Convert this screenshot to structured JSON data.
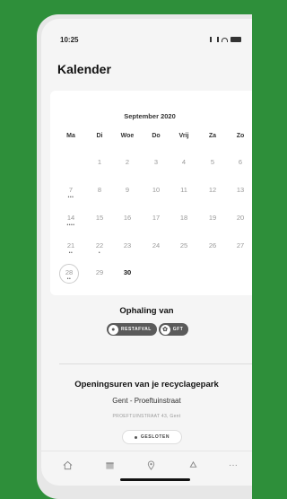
{
  "status_bar": {
    "time": "10:25"
  },
  "header": {
    "title": "Kalender"
  },
  "calendar": {
    "month": "September 2020",
    "weekdays": [
      "Ma",
      "Di",
      "Woe",
      "Do",
      "Vrij",
      "Za",
      "Zo"
    ],
    "weeks": [
      [
        "",
        "1",
        "2",
        "3",
        "4",
        "5",
        "6"
      ],
      [
        "7",
        "8",
        "9",
        "10",
        "11",
        "12",
        "13"
      ],
      [
        "14",
        "15",
        "16",
        "17",
        "18",
        "19",
        "20"
      ],
      [
        "21",
        "22",
        "23",
        "24",
        "25",
        "26",
        "27"
      ],
      [
        "28",
        "29",
        "30",
        "",
        "",
        "",
        ""
      ]
    ]
  },
  "ophaling": {
    "title": "Ophaling van",
    "items": [
      {
        "label": "RESTAFVAL",
        "icon": "trash-bag-icon"
      },
      {
        "label": "GFT",
        "icon": "leaf-icon"
      }
    ]
  },
  "recyclagepark": {
    "title": "Openingsuren van je recyclagepark",
    "location": "Gent - Proeftuinstraat",
    "address": "PROEFTUINSTRAAT 43, Gent",
    "status": "GESLOTEN"
  },
  "nav": {
    "items": [
      {
        "name": "home",
        "icon": "home-icon"
      },
      {
        "name": "calendar",
        "icon": "calendar-icon"
      },
      {
        "name": "location",
        "icon": "map-pin-icon"
      },
      {
        "name": "recycle",
        "icon": "recycle-icon"
      },
      {
        "name": "more",
        "icon": "more-icon"
      }
    ]
  }
}
